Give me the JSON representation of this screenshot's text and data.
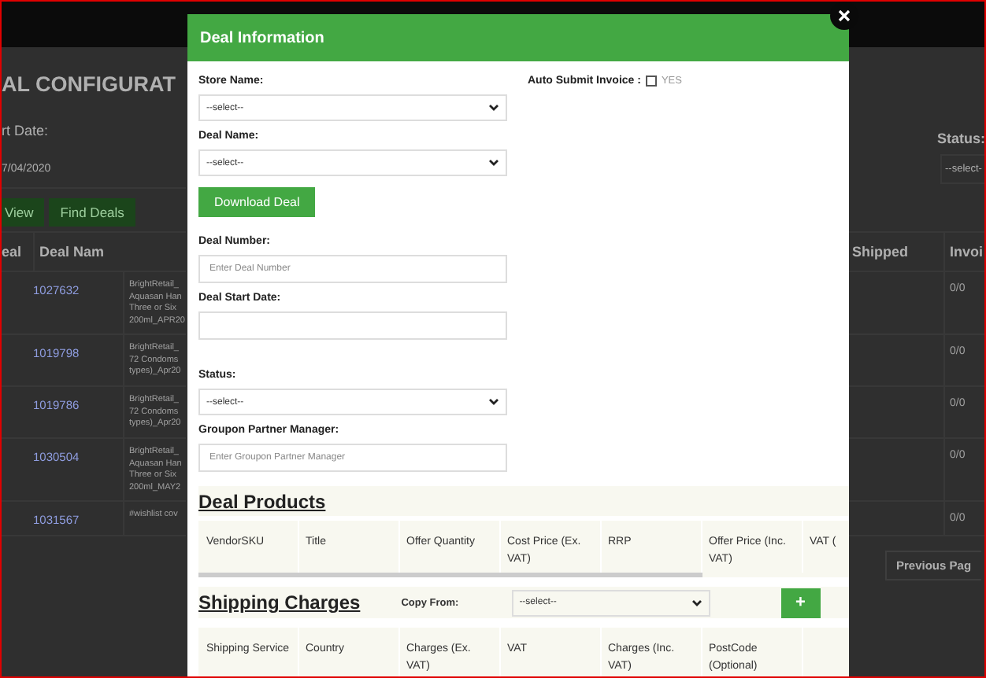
{
  "background": {
    "heading": "AL CONFIGURAT",
    "start_date_label": "rt Date:",
    "start_date_value": "7/04/2020",
    "buttons": [
      "View",
      "Find Deals"
    ],
    "status_label": "Status:",
    "status_value": "--select-",
    "columns": [
      "eal",
      "Deal Nam",
      "Shipped",
      "Invoi"
    ],
    "rows": [
      {
        "deal": "1027632",
        "name": [
          "BrightRetail_",
          "Aquasan Han",
          "Three or Six",
          "200ml_APR20"
        ],
        "invoiced": "0/0"
      },
      {
        "deal": "1019798",
        "name": [
          "BrightRetail_",
          "72 Condoms",
          "types)_Apr20"
        ],
        "invoiced": "0/0"
      },
      {
        "deal": "1019786",
        "name": [
          "BrightRetail_",
          "72 Condoms",
          "types)_Apr20"
        ],
        "invoiced": "0/0"
      },
      {
        "deal": "1030504",
        "name": [
          "BrightRetail_",
          "Aquasan Han",
          "Three or Six",
          "200ml_MAY2"
        ],
        "invoiced": "0/0"
      },
      {
        "deal": "1031567",
        "name": [
          "#wishlist cov"
        ],
        "invoiced": "0/0"
      }
    ],
    "pagination_button": "Previous Pag"
  },
  "modal": {
    "title": "Deal Information",
    "auto_submit": {
      "label": "Auto Submit Invoice :",
      "checked": false,
      "option": "YES"
    },
    "fields": [
      {
        "kind": "select",
        "label": "Store Name:",
        "value": "--select--"
      },
      {
        "kind": "select",
        "label": "Deal Name:",
        "value": "--select--"
      },
      {
        "kind": "button",
        "label": "Download Deal"
      },
      {
        "kind": "input",
        "label": "Deal Number:",
        "placeholder": "Enter Deal Number"
      },
      {
        "kind": "date",
        "label": "Deal Start Date:"
      },
      {
        "kind": "select",
        "label": "Status:",
        "value": "--select--"
      },
      {
        "kind": "input",
        "label": "Groupon Partner Manager:",
        "placeholder": "Enter Groupon Partner Manager"
      }
    ],
    "products": {
      "title": "Deal Products",
      "columns": [
        "VendorSKU",
        "Title",
        "Offer Quantity",
        "Cost Price (Ex. VAT)",
        "RRP",
        "Offer Price (Inc. VAT)",
        "VAT ("
      ]
    },
    "shipping": {
      "title": "Shipping Charges",
      "copy_from_label": "Copy From:",
      "copy_from_value": "--select--",
      "add_button": "+",
      "columns": [
        "Shipping Service",
        "Country",
        "Charges (Ex. VAT)",
        "VAT",
        "Charges (Inc. VAT)",
        "PostCode (Optional)",
        ""
      ]
    }
  }
}
